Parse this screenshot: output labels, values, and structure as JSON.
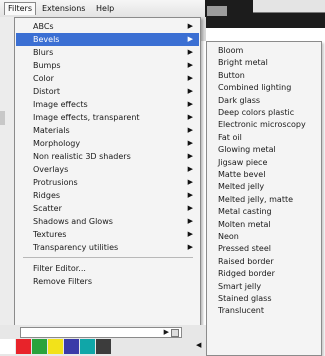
{
  "menubar": {
    "filters": "Filters",
    "extensions": "Extensions",
    "help": "Help"
  },
  "filters_menu": {
    "items": [
      {
        "label": "ABCs",
        "submenu": true
      },
      {
        "label": "Bevels",
        "submenu": true,
        "active": true
      },
      {
        "label": "Blurs",
        "submenu": true
      },
      {
        "label": "Bumps",
        "submenu": true
      },
      {
        "label": "Color",
        "submenu": true
      },
      {
        "label": "Distort",
        "submenu": true
      },
      {
        "label": "Image effects",
        "submenu": true
      },
      {
        "label": "Image effects, transparent",
        "submenu": true
      },
      {
        "label": "Materials",
        "submenu": true
      },
      {
        "label": "Morphology",
        "submenu": true
      },
      {
        "label": "Non realistic 3D shaders",
        "submenu": true
      },
      {
        "label": "Overlays",
        "submenu": true
      },
      {
        "label": "Protrusions",
        "submenu": true
      },
      {
        "label": "Ridges",
        "submenu": true
      },
      {
        "label": "Scatter",
        "submenu": true
      },
      {
        "label": "Shadows and Glows",
        "submenu": true
      },
      {
        "label": "Textures",
        "submenu": true
      },
      {
        "label": "Transparency utilities",
        "submenu": true
      }
    ],
    "footer_items": [
      {
        "label": "Filter Editor..."
      },
      {
        "label": "Remove Filters"
      }
    ],
    "arrow_glyph": "▶"
  },
  "bevels_submenu": {
    "items": [
      "Bloom",
      "Bright metal",
      "Button",
      "Combined lighting",
      "Dark glass",
      "Deep colors plastic",
      "Electronic microscopy",
      "Fat oil",
      "Glowing metal",
      "Jigsaw piece",
      "Matte bevel",
      "Melted jelly",
      "Melted jelly, matte",
      "Metal casting",
      "Molten metal",
      "Neon",
      "Pressed steel",
      "Raised border",
      "Ridged border",
      "Smart jelly",
      "Stained glass",
      "Translucent"
    ]
  },
  "palette": {
    "swatches": [
      "#ffffff",
      "#e8232a",
      "#2aa33c",
      "#f2e21a",
      "#3a3aa8",
      "#10a6a8",
      "#3c3c3c"
    ]
  },
  "colors": {
    "highlight": "#3b6fd3",
    "menu_bg": "#f4f4f4"
  }
}
